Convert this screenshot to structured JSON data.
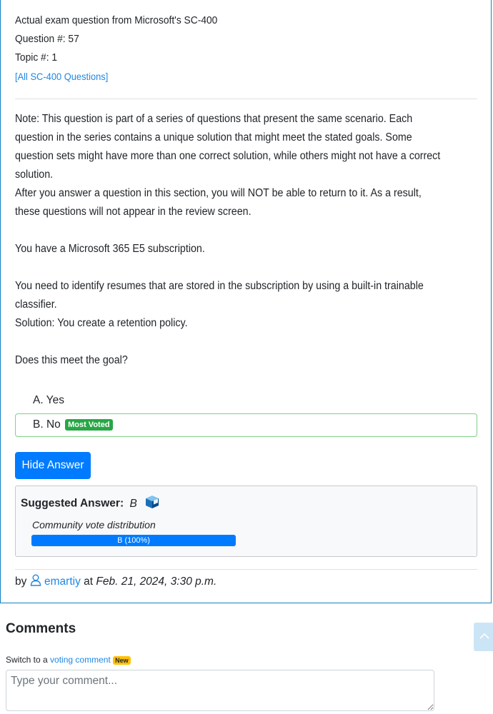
{
  "question": {
    "exam_line": "Actual exam question from Microsoft's SC-400",
    "number_line": "Question #: 57",
    "topic_line": "Topic #: 1",
    "all_link": "[All SC-400 Questions]",
    "paragraphs": [
      "Note: This question is part of a series of questions that present the same scenario. Each question in the series contains a unique solution that might meet the stated goals. Some question sets might have more than one correct solution, while others might not have a correct solution.",
      "After you answer a question in this section, you will NOT be able to return to it. As a result, these questions will not appear in the review screen.",
      "You have a Microsoft 365 E5 subscription.",
      "You need to identify resumes that are stored in the subscription by using a built-in trainable classifier.",
      "Solution: You create a retention policy.",
      "Does this meet the goal?"
    ],
    "choices": [
      {
        "label": "A. Yes"
      },
      {
        "label": "B. No",
        "badge": "Most Voted"
      }
    ]
  },
  "answer": {
    "hide_button": "Hide Answer",
    "suggested_label": "Suggested Answer:",
    "suggested_value": "B",
    "distribution_label": "Community vote distribution",
    "distribution": [
      {
        "label": "B (100%)",
        "fraction": 1.0
      }
    ],
    "bar_color": "#007bff"
  },
  "author": {
    "by": "by",
    "username": "emartiy",
    "at": "at",
    "date": "Feb. 21, 2024, 3:30 p.m."
  },
  "comments": {
    "heading": "Comments",
    "switch_text": "Switch to a",
    "switch_link": "voting comment",
    "new_badge": "New",
    "placeholder": "Type your comment..."
  },
  "icons": {
    "user": "user-outline-icon",
    "cube": "cube-icon",
    "scroll": "chevron-up-icon"
  }
}
